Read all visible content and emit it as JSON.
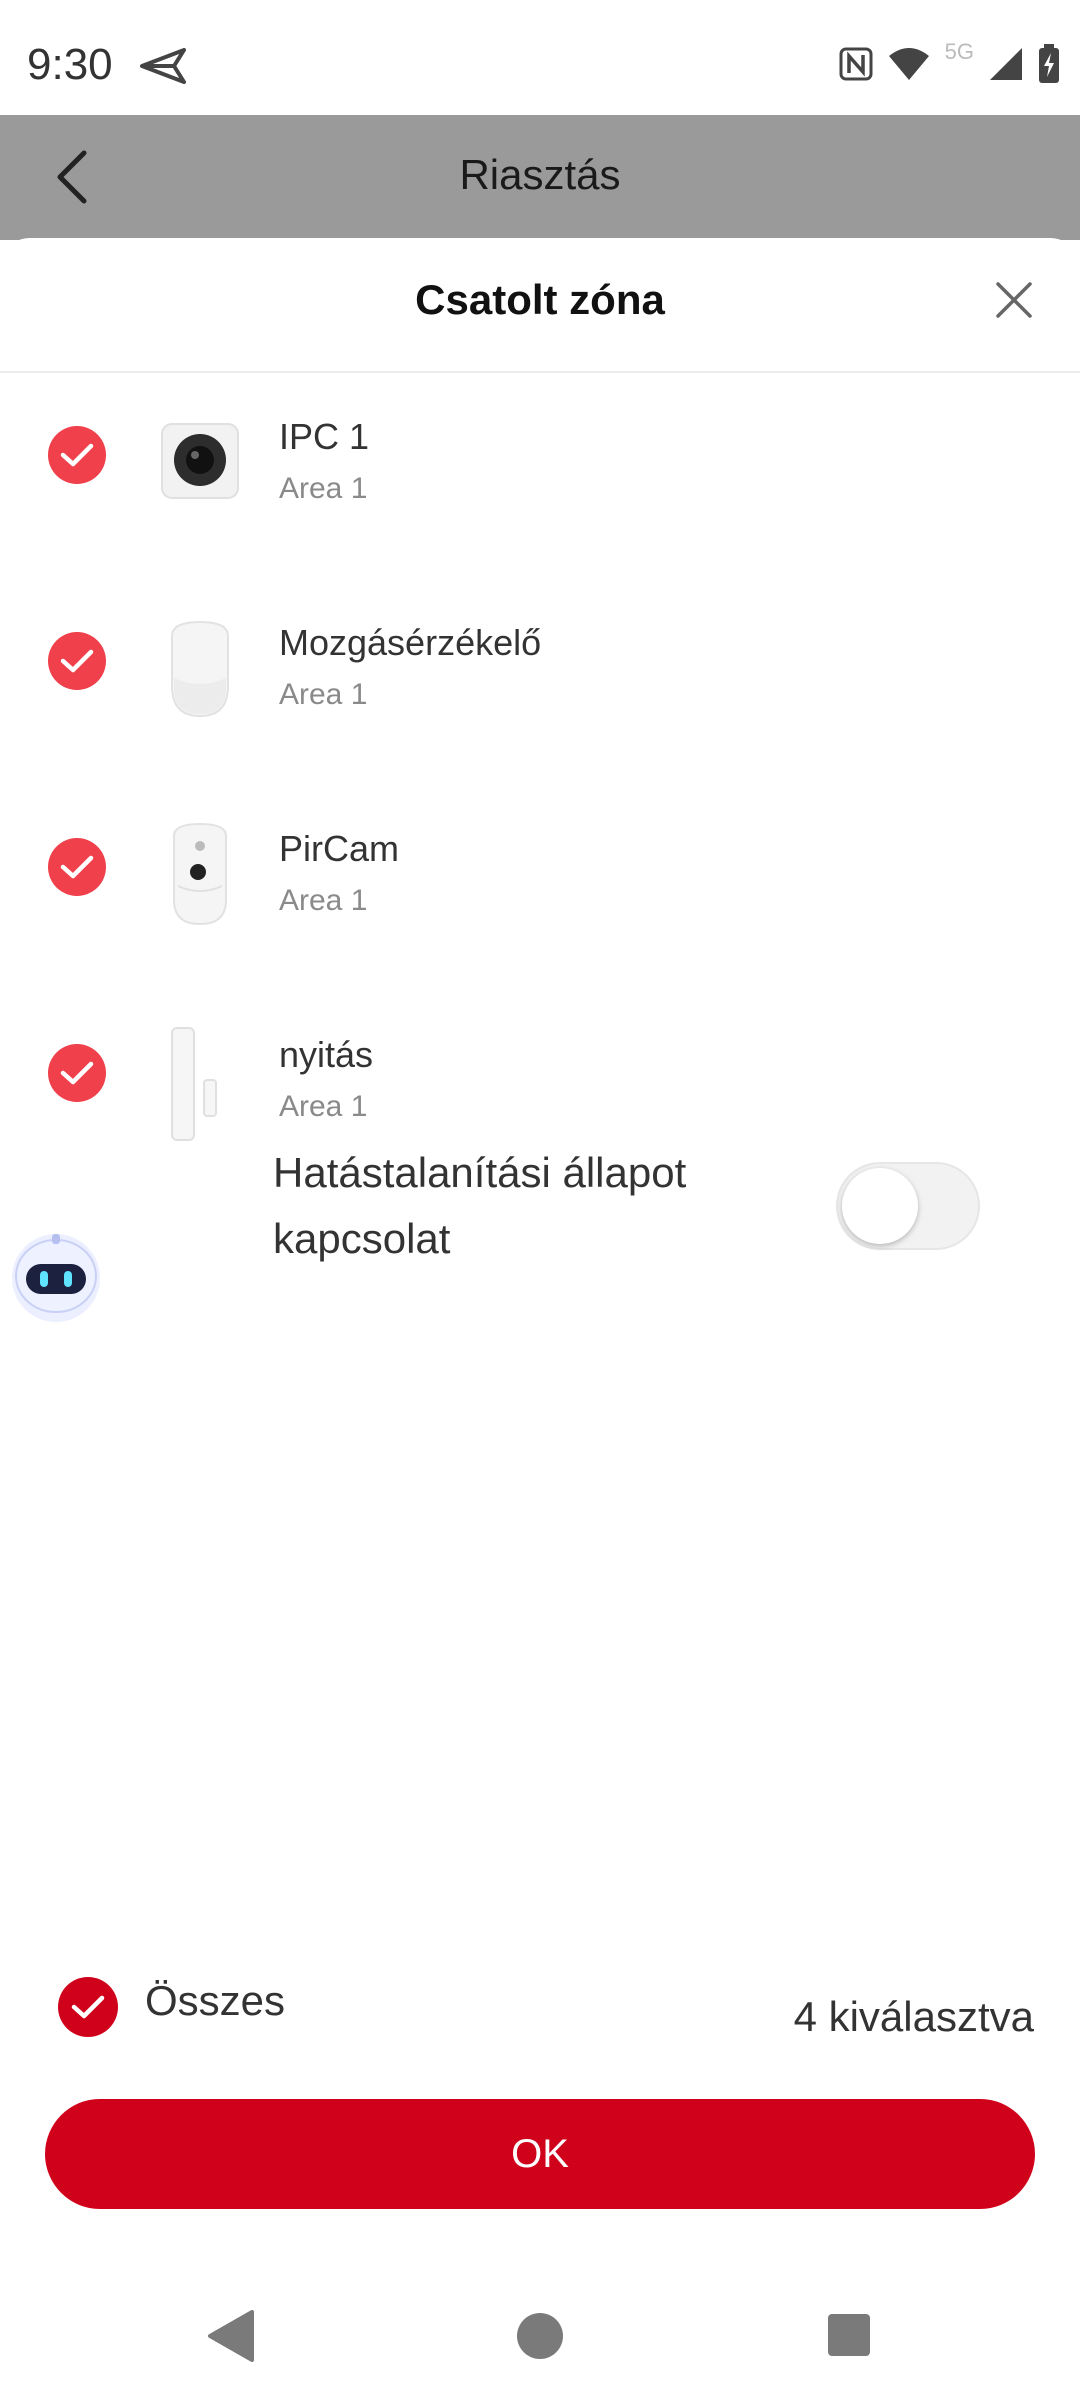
{
  "status_bar": {
    "time": "9:30",
    "network_label": "5G",
    "icons": [
      "send-icon",
      "nfc-icon",
      "wifi-icon",
      "signal-icon",
      "battery-icon"
    ]
  },
  "app_bar": {
    "title": "Riasztás",
    "back_icon": "back-arrow-icon"
  },
  "sheet": {
    "title": "Csatolt zóna",
    "close_icon": "close-icon",
    "devices": [
      {
        "name": "IPC 1",
        "area": "Area 1",
        "selected": true,
        "icon": "camera-device-icon"
      },
      {
        "name": "Mozgásérzékelő",
        "area": "Area 1",
        "selected": true,
        "icon": "motion-sensor-icon"
      },
      {
        "name": "PirCam",
        "area": "Area 1",
        "selected": true,
        "icon": "pircam-device-icon"
      },
      {
        "name": "nyitás",
        "area": "Area 1",
        "selected": true,
        "icon": "door-contact-icon"
      }
    ],
    "disarm_toggle": {
      "label": "Hatástalanítási állapot kapcsolat",
      "on": false
    },
    "select_all": {
      "label": "Összes",
      "checked": true
    },
    "selected_count": "4 kiválasztva",
    "ok_label": "OK"
  },
  "colors": {
    "accent": "#d0021b",
    "check": "#f0404b",
    "app_bar": "#9a9a9a"
  }
}
